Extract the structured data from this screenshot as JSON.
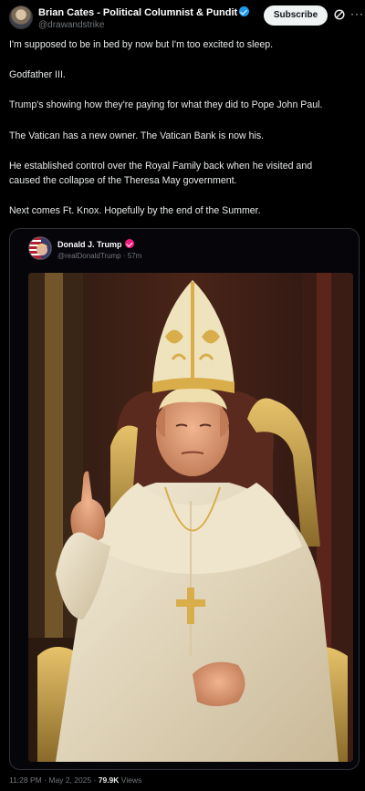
{
  "post": {
    "author_name": "Brian Cates - Political Columnist & Pundit",
    "author_handle": "@drawandstrike",
    "subscribe_label": "Subscribe",
    "more_label": "···",
    "paragraphs": [
      "I'm supposed to be in bed by now but I'm too excited to sleep.",
      "Godfather III.",
      "Trump's showing how they're paying for what they did to Pope John Paul.",
      "The Vatican has a new owner.  The Vatican Bank is now his.",
      "He established control over the Royal Family back when he visited and",
      "caused the collapse of the Theresa May government.",
      "Next comes Ft. Knox. Hopefully by the end of the Summer."
    ],
    "time": "11:28 PM",
    "date": "May 2, 2025",
    "separator": "·",
    "views_count": "79.9K",
    "views_label": "Views"
  },
  "quoted": {
    "name": "Donald J. Trump",
    "handle": "@realDonaldTrump",
    "time_ago": "57m",
    "image_description_icon": "pope-portrait-image"
  },
  "colors": {
    "background": "#000000",
    "text": "#e7e9ea",
    "muted": "#71767b",
    "verified_blue": "#1d9bf0",
    "verified_pink": "#f91880"
  }
}
